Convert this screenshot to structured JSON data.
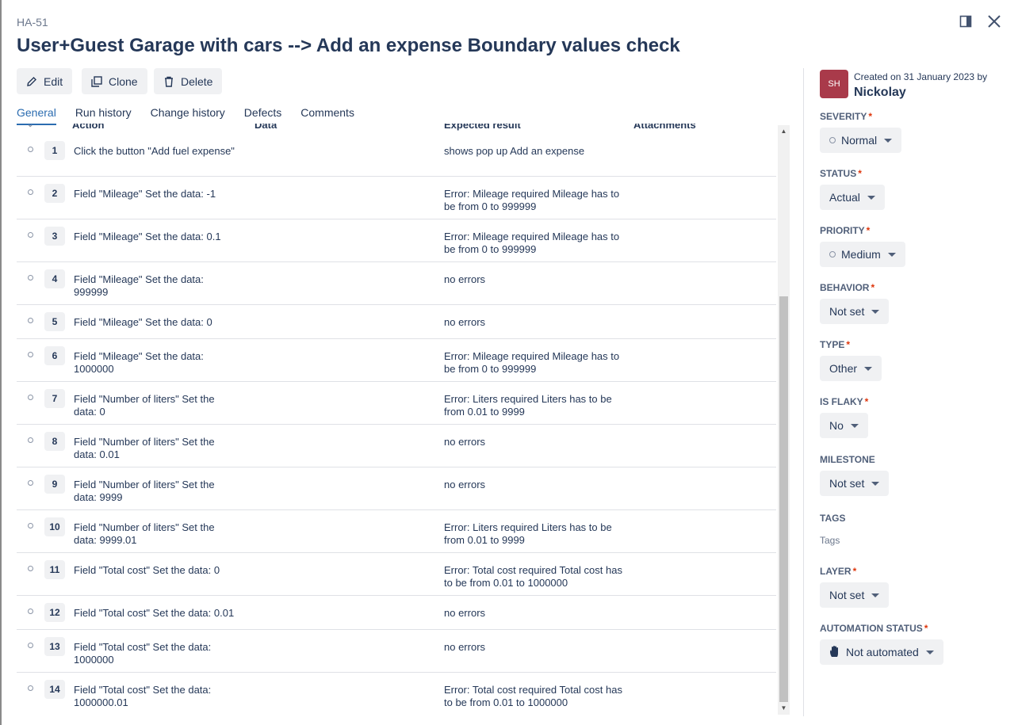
{
  "header": {
    "key": "HA-51",
    "title": "User+Guest Garage with cars --> Add an expense Boundary values check"
  },
  "toolbar": {
    "edit_label": "Edit",
    "clone_label": "Clone",
    "delete_label": "Delete"
  },
  "tabs": [
    {
      "label": "General",
      "active": true
    },
    {
      "label": "Run history",
      "active": false
    },
    {
      "label": "Change history",
      "active": false
    },
    {
      "label": "Defects",
      "active": false
    },
    {
      "label": "Comments",
      "active": false
    }
  ],
  "table": {
    "columns": [
      "Action",
      "Data",
      "Expected result",
      "Attachments"
    ],
    "rows": [
      {
        "num": "1",
        "action": "Click the button \"Add fuel expense\"",
        "expected": "shows pop up Add an expense"
      },
      {
        "num": "2",
        "action": "Field \"Mileage\" Set the data: -1",
        "expected": "Error: Mileage required Mileage has to be from 0 to 999999"
      },
      {
        "num": "3",
        "action": "Field \"Mileage\" Set the data: 0.1",
        "expected": "Error: Mileage required Mileage has to be from 0 to 999999"
      },
      {
        "num": "4",
        "action": "Field \"Mileage\" Set the data: 999999",
        "expected": "no errors"
      },
      {
        "num": "5",
        "action": "Field \"Mileage\" Set the data: 0",
        "expected": "no errors"
      },
      {
        "num": "6",
        "action": "Field \"Mileage\" Set the data: 1000000",
        "expected": "Error: Mileage required Mileage has to be from 0 to 999999"
      },
      {
        "num": "7",
        "action": "Field \"Number of liters\" Set the data: 0",
        "expected": "Error: Liters required Liters has to be from 0.01 to 9999"
      },
      {
        "num": "8",
        "action": "Field \"Number of liters\" Set the data: 0.01",
        "expected": "no errors"
      },
      {
        "num": "9",
        "action": "Field \"Number of liters\" Set the data: 9999",
        "expected": "no errors"
      },
      {
        "num": "10",
        "action": "Field \"Number of liters\" Set the data: 9999.01",
        "expected": "Error: Liters required Liters has to be from 0.01 to 9999"
      },
      {
        "num": "11",
        "action": "Field \"Total cost\" Set the data: 0",
        "expected": "Error: Total cost required Total cost has to be from 0.01 to 1000000"
      },
      {
        "num": "12",
        "action": "Field \"Total cost\" Set the data: 0.01",
        "expected": "no errors"
      },
      {
        "num": "13",
        "action": "Field \"Total cost\" Set the data: 1000000",
        "expected": "no errors"
      },
      {
        "num": "14",
        "action": "Field \"Total cost\" Set the data: 1000000.01",
        "expected": "Error: Total cost required Total cost has to be from 0.01 to 1000000"
      }
    ]
  },
  "sidebar": {
    "avatar_initials": "SH",
    "avatar_color": "#a93a4a",
    "created_text": "Created on 31 January 2023 by",
    "author": "Nickolay",
    "fields": [
      {
        "label": "SEVERITY",
        "required": true,
        "value": "Normal",
        "dot": true
      },
      {
        "label": "STATUS",
        "required": true,
        "value": "Actual",
        "dot": false
      },
      {
        "label": "PRIORITY",
        "required": true,
        "value": "Medium",
        "dot": true
      },
      {
        "label": "BEHAVIOR",
        "required": true,
        "value": "Not set",
        "dot": false
      },
      {
        "label": "TYPE",
        "required": true,
        "value": "Other",
        "dot": false
      },
      {
        "label": "IS FLAKY",
        "required": true,
        "value": "No",
        "dot": false
      },
      {
        "label": "MILESTONE",
        "required": false,
        "value": "Not set",
        "dot": false
      },
      {
        "label": "TAGS",
        "required": false,
        "placeholder": "Tags"
      },
      {
        "label": "LAYER",
        "required": true,
        "value": "Not set",
        "dot": false
      },
      {
        "label": "AUTOMATION STATUS",
        "required": true,
        "value": "Not automated",
        "icon": "hand-icon"
      }
    ]
  },
  "colors": {
    "accent": "#2b6cb0",
    "required": "#de350b"
  }
}
